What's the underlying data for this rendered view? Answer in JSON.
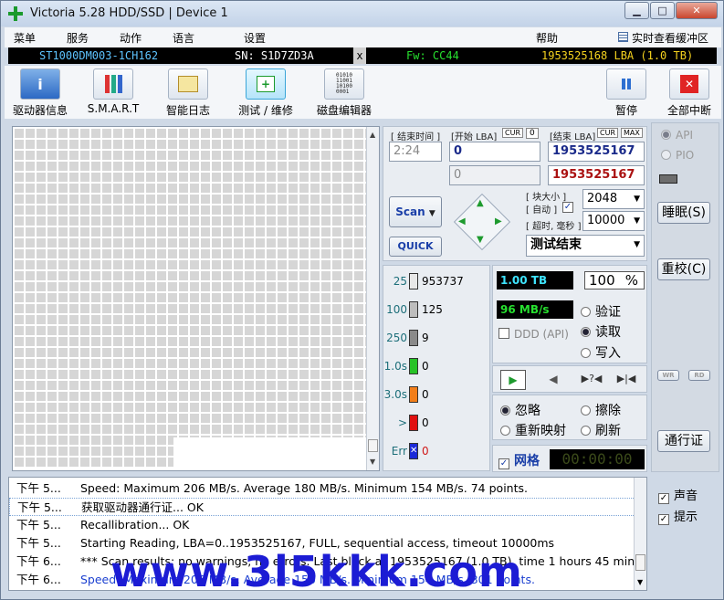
{
  "window": {
    "title": "Victoria 5.28 HDD/SSD | Device 1",
    "min": "▁",
    "max": "□",
    "close": "✕"
  },
  "menu": {
    "items": [
      "菜单",
      "服务",
      "动作",
      "语言",
      "设置"
    ],
    "help": "帮助",
    "buffer": "实时查看缓冲区"
  },
  "info": {
    "model": "ST1000DM003-1CH162",
    "sn": "SN: S1D7ZD3A",
    "x": "x",
    "fw": "Fw: CC44",
    "lba": "1953525168 LBA (1.0 TB)"
  },
  "toolbar": {
    "drive_info": "驱动器信息",
    "smart": "S.M.A.R.T",
    "log": "智能日志",
    "test": "测试 / 维修",
    "editor": "磁盘编辑器",
    "pause": "暂停",
    "stop_all": "全部中断",
    "editor_icon_text": "01010\n11001\n10100\n0001"
  },
  "scan": {
    "time_label": "[ 结束时间 ]",
    "time_value": "2:24",
    "start_lba_label": "[开始 LBA]",
    "cur": "CUR",
    "zero": "0",
    "end_lba_label": "[结束 LBA]",
    "max": "MAX",
    "start_lba": "0",
    "end_lba": "1953525167",
    "start_lba2": "0",
    "end_lba2": "1953525167",
    "block_label": "[ 块大小 ]",
    "auto_label": "[ 自动 ]",
    "timeout_label": "[ 超时, 毫秒 ]",
    "block_size": "2048",
    "timeout": "10000",
    "scan_btn": "Scan",
    "quick_btn": "QUICK",
    "result": "测试结束"
  },
  "stats": {
    "rows": [
      {
        "label": "25",
        "count": "953737",
        "color": "#e8e8e8"
      },
      {
        "label": "100",
        "count": "125",
        "color": "#bdbdbd"
      },
      {
        "label": "250",
        "count": "9",
        "color": "#8a8a8a"
      },
      {
        "label": "1.0s",
        "count": "0",
        "color": "#27c227"
      },
      {
        "label": "3.0s",
        "count": "0",
        "color": "#f27e1a"
      },
      {
        "label": ">",
        "count": "0",
        "color": "#e01010"
      },
      {
        "label": "Err",
        "count": "0",
        "color": "#1c2ad8"
      }
    ]
  },
  "progress": {
    "size": "1.00 TB",
    "percent": "100",
    "pct_sign": "%",
    "speed": "96 MB/s",
    "ddd": "DDD (API)",
    "verify": "验证",
    "read": "读取",
    "write": "写入"
  },
  "actions": {
    "ignore": "忽略",
    "erase": "擦除",
    "remap": "重新映射",
    "refresh": "刷新",
    "grid": "网格",
    "timer": "00:00:00"
  },
  "right": {
    "api": "API",
    "pio": "PIO",
    "sleep": "睡眠(S)",
    "recal": "重校(C)",
    "wr": "WR",
    "rd": "RD",
    "passport": "通行证",
    "sound": "声音",
    "hints": "提示"
  },
  "log": [
    {
      "time": "下午 5...",
      "msg": "Speed: Maximum 206 MB/s. Average 180 MB/s. Minimum 154 MB/s. 74 points."
    },
    {
      "time": "下午 5...",
      "msg": "获取驱动器通行证... OK"
    },
    {
      "time": "下午 5...",
      "msg": "Recallibration... OK"
    },
    {
      "time": "下午 5...",
      "msg": "Starting Reading, LBA=0..1953525167, FULL, sequential access, timeout 10000ms"
    },
    {
      "time": "下午 6...",
      "msg": "*** Scan results: no warnings, no errors. Last block at 1953525167 (1.0 TB), time 1 hours 45 minute..."
    },
    {
      "time": "下午 6...",
      "msg": "Speed: Maximum 206 MB/s. Average 150 MB/s. Minimum 154 MB/s. 301 points."
    }
  ],
  "watermark": "www.3l5kkk.com",
  "colors": {
    "speed_bg": "#000",
    "green_text": "#27e02f",
    "accent_blue": "#1a3fa8"
  }
}
